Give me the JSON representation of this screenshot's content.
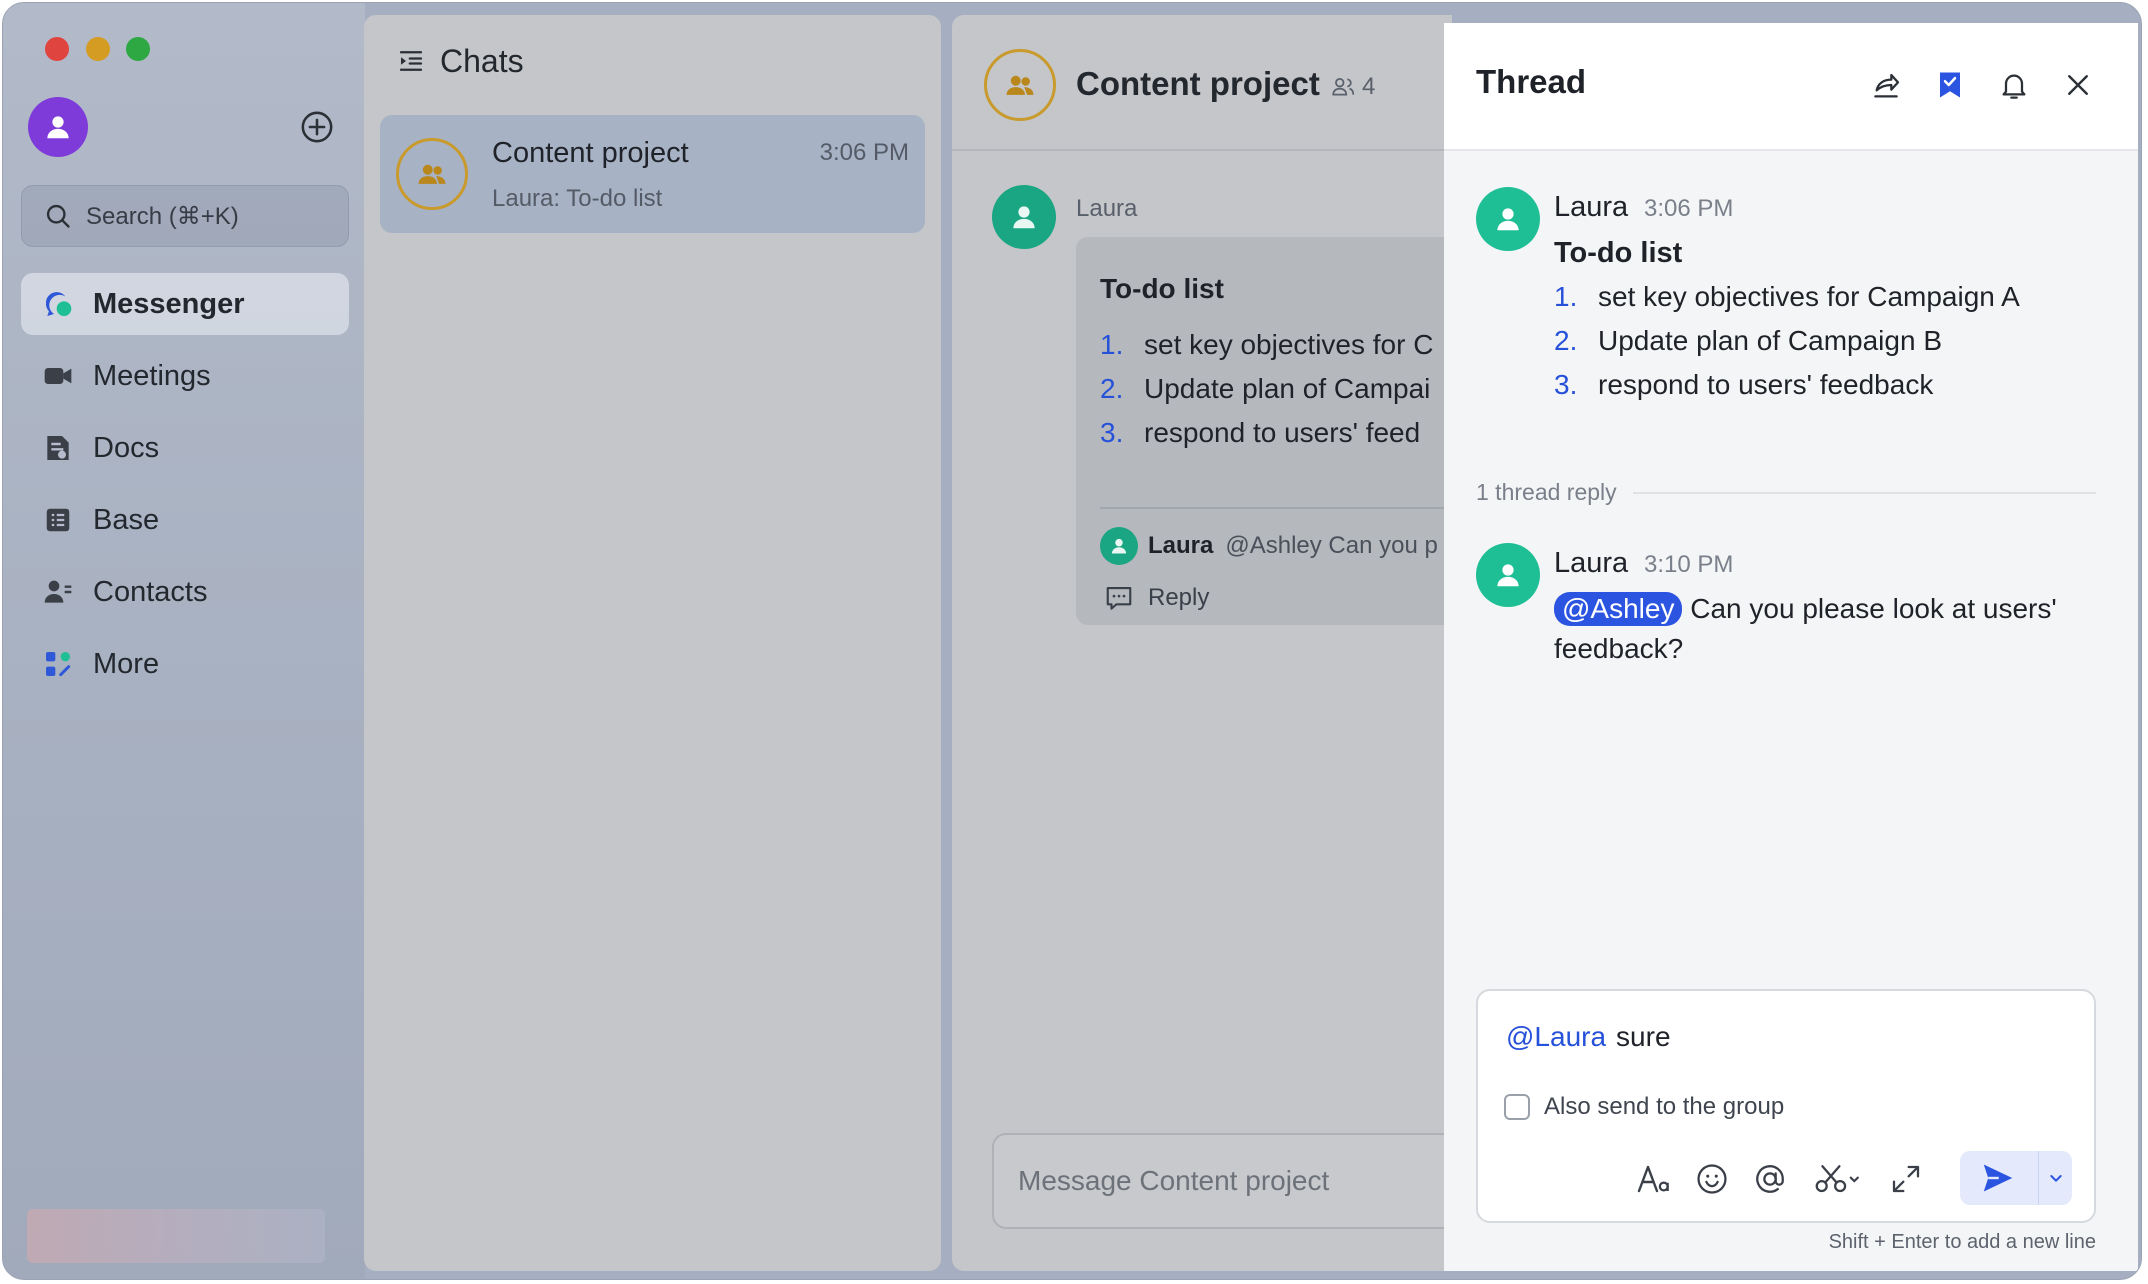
{
  "sidebar": {
    "search_placeholder": "Search (⌘+K)",
    "nav": [
      {
        "label": "Messenger",
        "icon": "messenger-icon",
        "active": true
      },
      {
        "label": "Meetings",
        "icon": "video-camera-icon"
      },
      {
        "label": "Docs",
        "icon": "docs-icon"
      },
      {
        "label": "Base",
        "icon": "base-table-icon"
      },
      {
        "label": "Contacts",
        "icon": "contacts-icon"
      },
      {
        "label": "More",
        "icon": "more-apps-icon"
      }
    ]
  },
  "chats": {
    "title": "Chats",
    "items": [
      {
        "name": "Content project",
        "time": "3:06 PM",
        "preview": "Laura: To-do list"
      }
    ]
  },
  "conversation": {
    "name": "Content project",
    "member_count": "4",
    "sender": "Laura",
    "card_title": "To-do list",
    "items": [
      {
        "num": "1.",
        "text": "set key objectives for C"
      },
      {
        "num": "2.",
        "text": "Update plan of Campai"
      },
      {
        "num": "3.",
        "text": "respond to users' feed"
      }
    ],
    "reply_preview_name": "Laura",
    "reply_preview_text": "@Ashley Can you p",
    "reply_label": "Reply",
    "input_placeholder": "Message Content project"
  },
  "thread": {
    "title": "Thread",
    "root": {
      "name": "Laura",
      "time": "3:06 PM",
      "title": "To-do list",
      "items": [
        {
          "num": "1.",
          "text": "set key objectives for Campaign A"
        },
        {
          "num": "2.",
          "text": "Update plan of Campaign B"
        },
        {
          "num": "3.",
          "text": "respond to users' feedback"
        }
      ]
    },
    "reply_count_label": "1 thread reply",
    "reply": {
      "name": "Laura",
      "time": "3:10 PM",
      "mention": "@Ashley",
      "text": "Can you please look at users' feedback?"
    },
    "composer": {
      "mention": "@Laura",
      "text": "sure",
      "checkbox_label": "Also send to the group"
    },
    "hint": "Shift + Enter to add a new line"
  },
  "colors": {
    "accent": "#2b55e0",
    "user_avatar": "#7f3bd9",
    "member_avatar": "#1fbf95",
    "group_ring": "#c99a2c"
  }
}
